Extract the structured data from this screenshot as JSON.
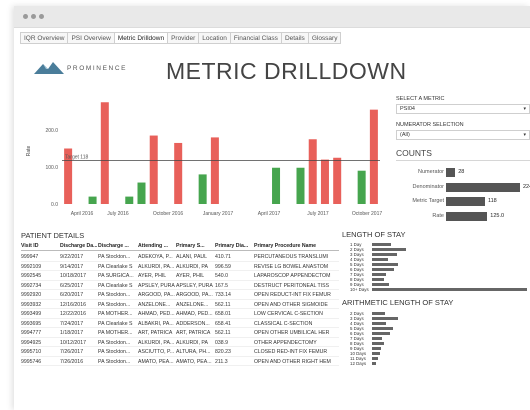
{
  "window": {
    "controls": [
      "close",
      "minimize",
      "maximize"
    ]
  },
  "tabs": [
    {
      "label": "IQR Overview",
      "active": false
    },
    {
      "label": "PSI Overview",
      "active": false
    },
    {
      "label": "Metric Drilldown",
      "active": true
    },
    {
      "label": "Provider",
      "active": false
    },
    {
      "label": "Location",
      "active": false
    },
    {
      "label": "Financial Class",
      "active": false
    },
    {
      "label": "Details",
      "active": false
    },
    {
      "label": "Glossary",
      "active": false
    }
  ],
  "header": {
    "logo_text": "PROMINENCE",
    "title": "METRIC DRILLDOWN"
  },
  "chart_data": {
    "type": "bar",
    "ylabel": "Rate",
    "ylim": [
      0,
      280
    ],
    "yticks": [
      "0.0",
      "100.0",
      "200.0"
    ],
    "target": {
      "label": "Target 118",
      "value": 118
    },
    "xtick_labels": [
      "April 2016",
      "July 2016",
      "October 2016",
      "January 2017",
      "April 2017",
      "July 2017",
      "October 2017"
    ],
    "values": [
      150,
      0,
      20,
      275,
      0,
      20,
      58,
      185,
      0,
      165,
      0,
      80,
      180,
      0,
      0,
      0,
      0,
      98,
      0,
      98,
      175,
      120,
      125,
      0,
      90,
      255
    ],
    "colors": {
      "above": "#e8605a",
      "below": "#46a54e",
      "target_line": "#444444"
    }
  },
  "filters": {
    "metric_label": "SELECT A METRIC",
    "metric_value": "PSI04",
    "numerator_label": "NUMERATOR SELECTION",
    "numerator_value": "(All)"
  },
  "counts": {
    "title": "COUNTS",
    "rows": [
      {
        "label": "Numerator",
        "value": 28,
        "display": "28"
      },
      {
        "label": "Denominator",
        "value": 224,
        "display": "224"
      },
      {
        "label": "Metric Target",
        "value": 118,
        "display": "118"
      },
      {
        "label": "Rate",
        "value": 125.0,
        "display": "125.0"
      }
    ]
  },
  "patient_details": {
    "title": "PATIENT DETAILS",
    "columns": [
      "Visit ID",
      "Discharge Da...",
      "Discharge ...",
      "Attending ...",
      "Primary S...",
      "Primary Dia...",
      "Primary Procedure Name"
    ],
    "rows": [
      [
        "999947",
        "9/22/2017",
        "PA Stockton...",
        "ADEKOYA, P...",
        "ALANI, PAUL",
        "410.71",
        "PERCUTANEOUS TRANSLUMI"
      ],
      [
        "9992109",
        "9/14/2017",
        "PA Clearlake S",
        "ALKURDI, PA...",
        "ALKURDI, PA",
        "996.59",
        "REVISE LG BOWEL ANASTOM"
      ],
      [
        "9992545",
        "10/18/2017",
        "PA SURGICA...",
        "AYER, PHIL",
        "AYER, PHIL",
        "540.0",
        "LAPAROSCOP APPENDECTOM"
      ],
      [
        "9992734",
        "6/25/2017",
        "PA Clearlake S",
        "APSLEY, PURA",
        "APSLEY, PURA",
        "167.5",
        "DESTRUCT PERITONEAL TISS"
      ],
      [
        "9992920",
        "6/20/2017",
        "PA Stockton...",
        "ARGOOD, PA...",
        "ARGOOD, PA...",
        "733.14",
        "OPEN REDUCT-INT FIX FEMUR"
      ],
      [
        "9993932",
        "12/16/2016",
        "PA Stockton...",
        "ANZELONE...",
        "ANZELONE...",
        "562.11",
        "OPEN AND OTHER SIGMOIDE"
      ],
      [
        "9993499",
        "12/22/2016",
        "PA MOTHER...",
        "AHMAD, PED...",
        "AHMAD, PED...",
        "658.01",
        "LOW CERVICAL C-SECTION"
      ],
      [
        "9993695",
        "7/24/2017",
        "PA Clearlake S",
        "ALBAKRI, PA...",
        "ADDERSON...",
        "658.41",
        "CLASSICAL C-SECTION"
      ],
      [
        "9994777",
        "1/18/2017",
        "PA MOTHER...",
        "ART, PATRICA",
        "ART, PATRICA",
        "562.11",
        "OPEN OTHER UMBILICAL HER"
      ],
      [
        "9994925",
        "10/12/2017",
        "PA Stockton...",
        "ALKURDI, PA...",
        "ALKURDI, PA",
        "038.9",
        "OTHER APPENDECTOMY"
      ],
      [
        "9995710",
        "7/26/2017",
        "PA Stockton...",
        "ASCIUTTO, P...",
        "ALTURA, PH...",
        "820.23",
        "CLOSED RED-INT FIX FEMUR"
      ],
      [
        "9995746",
        "7/26/2016",
        "PA Stockton...",
        "AMATO, PEA...",
        "AMATO, PEA...",
        "211.3",
        "OPEN AND OTHER RIGHT HEM"
      ]
    ]
  },
  "length_of_stay": {
    "title": "LENGTH OF STAY",
    "rows": [
      {
        "label": "1 Day",
        "value": 12
      },
      {
        "label": "2 Days",
        "value": 22
      },
      {
        "label": "3 Days",
        "value": 16
      },
      {
        "label": "4 Days",
        "value": 10
      },
      {
        "label": "5 Days",
        "value": 17
      },
      {
        "label": "6 Days",
        "value": 14
      },
      {
        "label": "7 Days",
        "value": 9
      },
      {
        "label": "8 Days",
        "value": 8
      },
      {
        "label": "9 Days",
        "value": 11
      },
      {
        "label": "10+ Days",
        "value": 100
      }
    ]
  },
  "arith_length_of_stay": {
    "title": "ARITHMETIC LENGTH OF STAY",
    "rows": [
      {
        "label": "2 Days",
        "value": 20
      },
      {
        "label": "3 Days",
        "value": 40
      },
      {
        "label": "4 Days",
        "value": 22
      },
      {
        "label": "5 Days",
        "value": 32
      },
      {
        "label": "6 Days",
        "value": 27
      },
      {
        "label": "7 Days",
        "value": 15
      },
      {
        "label": "8 Days",
        "value": 18
      },
      {
        "label": "9 Days",
        "value": 14
      },
      {
        "label": "10 Days",
        "value": 12
      },
      {
        "label": "11 Days",
        "value": 9
      },
      {
        "label": "12 Days",
        "value": 6
      }
    ]
  }
}
